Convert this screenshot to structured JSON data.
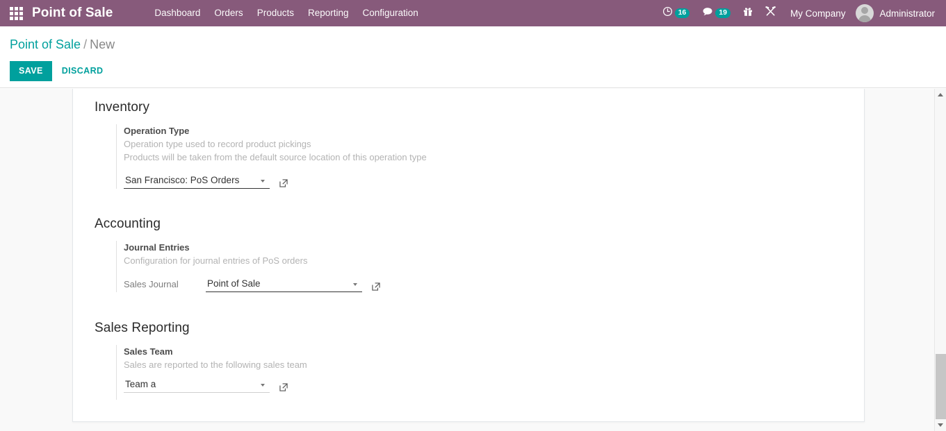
{
  "navbar": {
    "apps_icon": "apps-grid-icon",
    "brand": "Point of Sale",
    "menu_items": [
      {
        "label": "Dashboard"
      },
      {
        "label": "Orders"
      },
      {
        "label": "Products"
      },
      {
        "label": "Reporting"
      },
      {
        "label": "Configuration"
      }
    ],
    "systray": {
      "activities": {
        "icon": "clock-icon",
        "count": "16"
      },
      "messages": {
        "icon": "chat-bubble-icon",
        "count": "19"
      },
      "enterprise": {
        "icon": "gift-icon"
      },
      "debug": {
        "icon": "wrench-tools-icon"
      },
      "company": "My Company",
      "avatar_icon": "user-avatar-icon",
      "user": "Administrator"
    },
    "accent_color": "#875A7B",
    "badge_color": "#00A09D"
  },
  "control_panel": {
    "breadcrumb": {
      "root": "Point of Sale",
      "separator": "/",
      "current": "New"
    },
    "save_label": "SAVE",
    "discard_label": "DISCARD",
    "accent_color": "#00A09D"
  },
  "form": {
    "sections": [
      {
        "title": "Inventory",
        "groups": [
          {
            "label": "Operation Type",
            "help_lines": [
              "Operation type used to record product pickings",
              "Products will be taken from the default source location of this operation type"
            ],
            "field": {
              "label": "",
              "value": "San Francisco: PoS Orders",
              "placeholder": "",
              "has_dropdown": true,
              "external_link_icon": "external-link-icon"
            }
          }
        ]
      },
      {
        "title": "Accounting",
        "groups": [
          {
            "label": "Journal Entries",
            "help_lines": [
              "Configuration for journal entries of PoS orders"
            ],
            "field": {
              "label": "Sales Journal",
              "value": "Point of Sale",
              "placeholder": "",
              "has_dropdown": true,
              "external_link_icon": "external-link-icon"
            }
          }
        ]
      },
      {
        "title": "Sales Reporting",
        "groups": [
          {
            "label": "Sales Team",
            "help_lines": [
              "Sales are reported to the following sales team"
            ],
            "field": {
              "label": "",
              "value": "Team a",
              "placeholder": "",
              "has_dropdown": true,
              "external_link_icon": "external-link-icon"
            }
          }
        ]
      }
    ]
  },
  "scrollbar": {
    "up_icon": "chevron-up-icon",
    "down_icon": "chevron-down-icon"
  }
}
